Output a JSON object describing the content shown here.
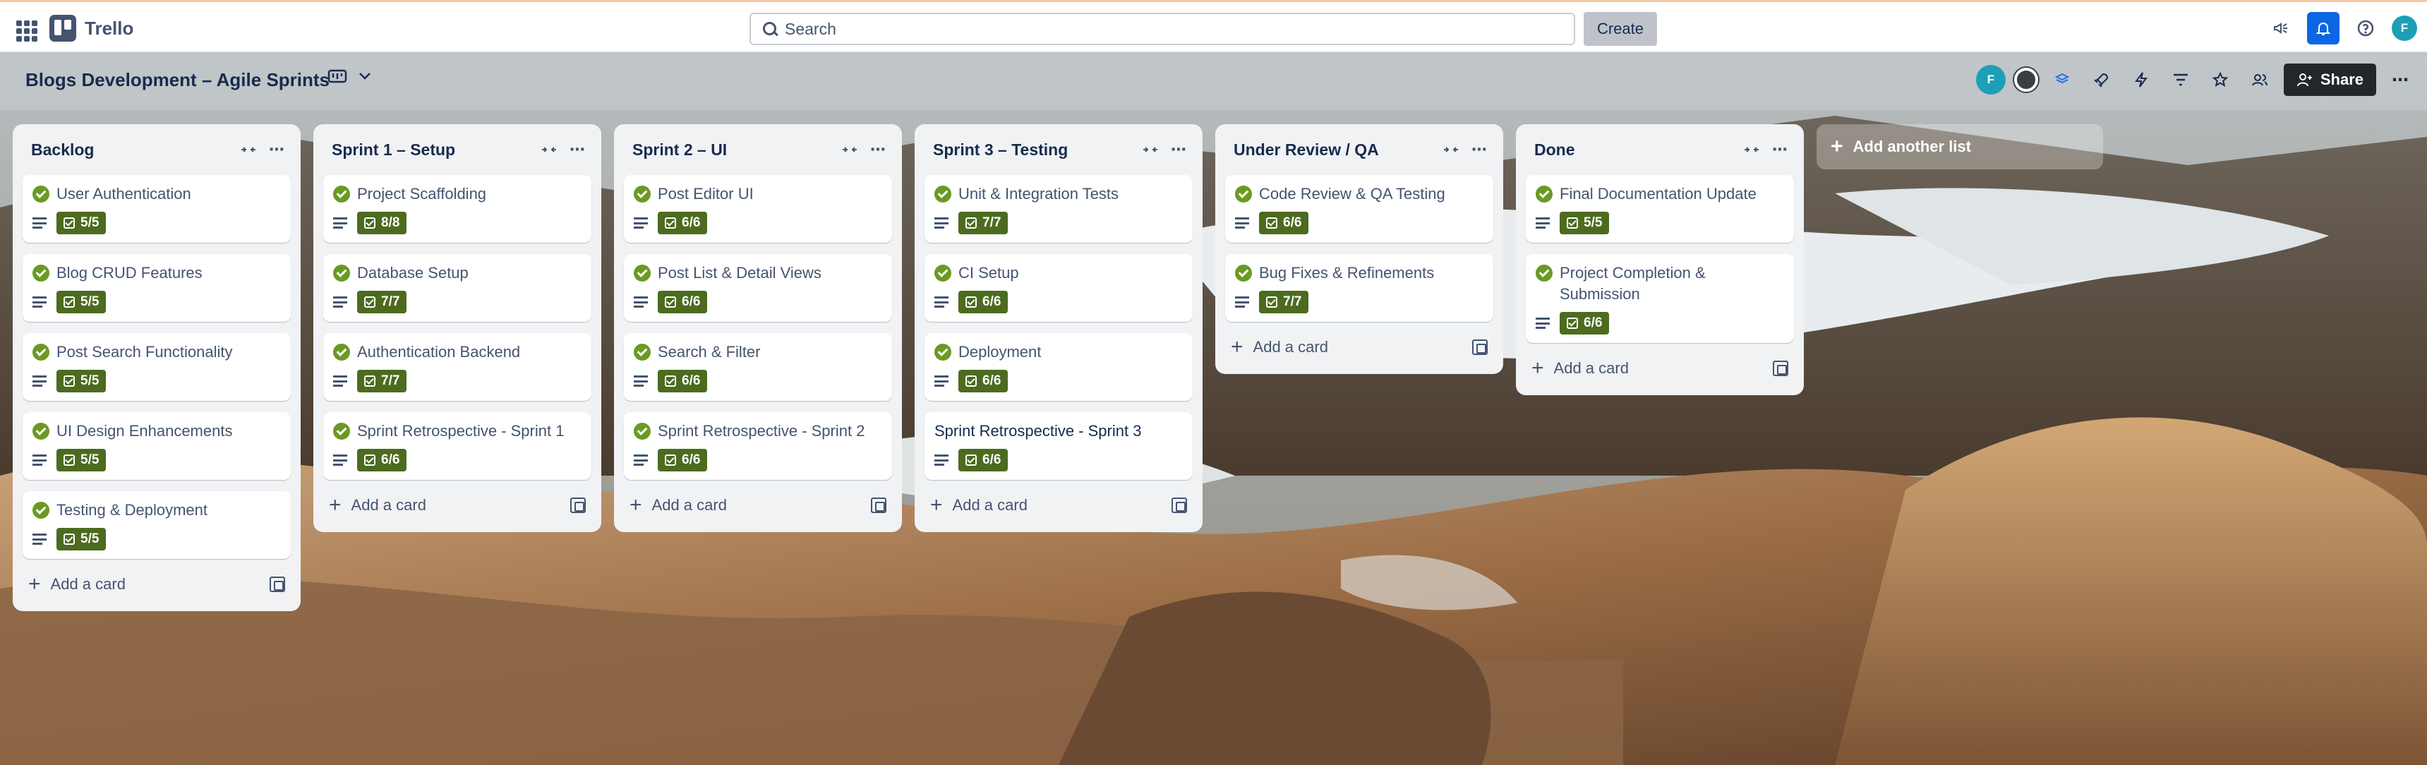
{
  "app": {
    "name": "Trello"
  },
  "search": {
    "placeholder": "Search"
  },
  "toolbar": {
    "create_label": "Create",
    "user_initial": "F"
  },
  "board": {
    "title": "Blogs Development – Agile Sprints",
    "member_initial": "F",
    "share_label": "Share"
  },
  "lists": [
    {
      "title": "Backlog",
      "cards": [
        {
          "title": "User Authentication",
          "completed": true,
          "checklist": "5/5"
        },
        {
          "title": "Blog CRUD Features",
          "completed": true,
          "checklist": "5/5"
        },
        {
          "title": "Post Search Functionality",
          "completed": true,
          "checklist": "5/5"
        },
        {
          "title": "UI Design Enhancements",
          "completed": true,
          "checklist": "5/5"
        },
        {
          "title": "Testing & Deployment",
          "completed": true,
          "checklist": "5/5"
        }
      ],
      "add_card_label": "Add a card"
    },
    {
      "title": "Sprint 1 – Setup",
      "cards": [
        {
          "title": "Project Scaffolding",
          "completed": true,
          "checklist": "8/8"
        },
        {
          "title": "Database Setup",
          "completed": true,
          "checklist": "7/7"
        },
        {
          "title": "Authentication Backend",
          "completed": true,
          "checklist": "7/7"
        },
        {
          "title": "Sprint Retrospective - Sprint 1",
          "completed": true,
          "checklist": "6/6"
        }
      ],
      "add_card_label": "Add a card"
    },
    {
      "title": "Sprint 2 – UI",
      "cards": [
        {
          "title": "Post Editor UI",
          "completed": true,
          "checklist": "6/6"
        },
        {
          "title": "Post List & Detail Views",
          "completed": true,
          "checklist": "6/6"
        },
        {
          "title": "Search & Filter",
          "completed": true,
          "checklist": "6/6"
        },
        {
          "title": "Sprint Retrospective - Sprint 2",
          "completed": true,
          "checklist": "6/6"
        }
      ],
      "add_card_label": "Add a card"
    },
    {
      "title": "Sprint 3 – Testing",
      "cards": [
        {
          "title": "Unit & Integration Tests",
          "completed": true,
          "checklist": "7/7"
        },
        {
          "title": "CI Setup",
          "completed": true,
          "checklist": "6/6"
        },
        {
          "title": "Deployment",
          "completed": true,
          "checklist": "6/6"
        },
        {
          "title": "Sprint Retrospective - Sprint 3",
          "completed": false,
          "checklist": "6/6"
        }
      ],
      "add_card_label": "Add a card"
    },
    {
      "title": "Under Review / QA",
      "cards": [
        {
          "title": "Code Review & QA Testing",
          "completed": true,
          "checklist": "6/6"
        },
        {
          "title": "Bug Fixes & Refinements",
          "completed": true,
          "checklist": "7/7"
        }
      ],
      "add_card_label": "Add a card"
    },
    {
      "title": "Done",
      "cards": [
        {
          "title": "Final Documentation Update",
          "completed": true,
          "checklist": "5/5"
        },
        {
          "title": "Project Completion & Submission",
          "completed": true,
          "checklist": "6/6"
        }
      ],
      "add_card_label": "Add a card"
    }
  ],
  "add_list_label": "Add another list",
  "colors": {
    "checklist_badge": "#4c6b1f",
    "complete_check": "#6a9a23",
    "list_bg": "#f1f2f4",
    "accent": "#0c66e4"
  }
}
